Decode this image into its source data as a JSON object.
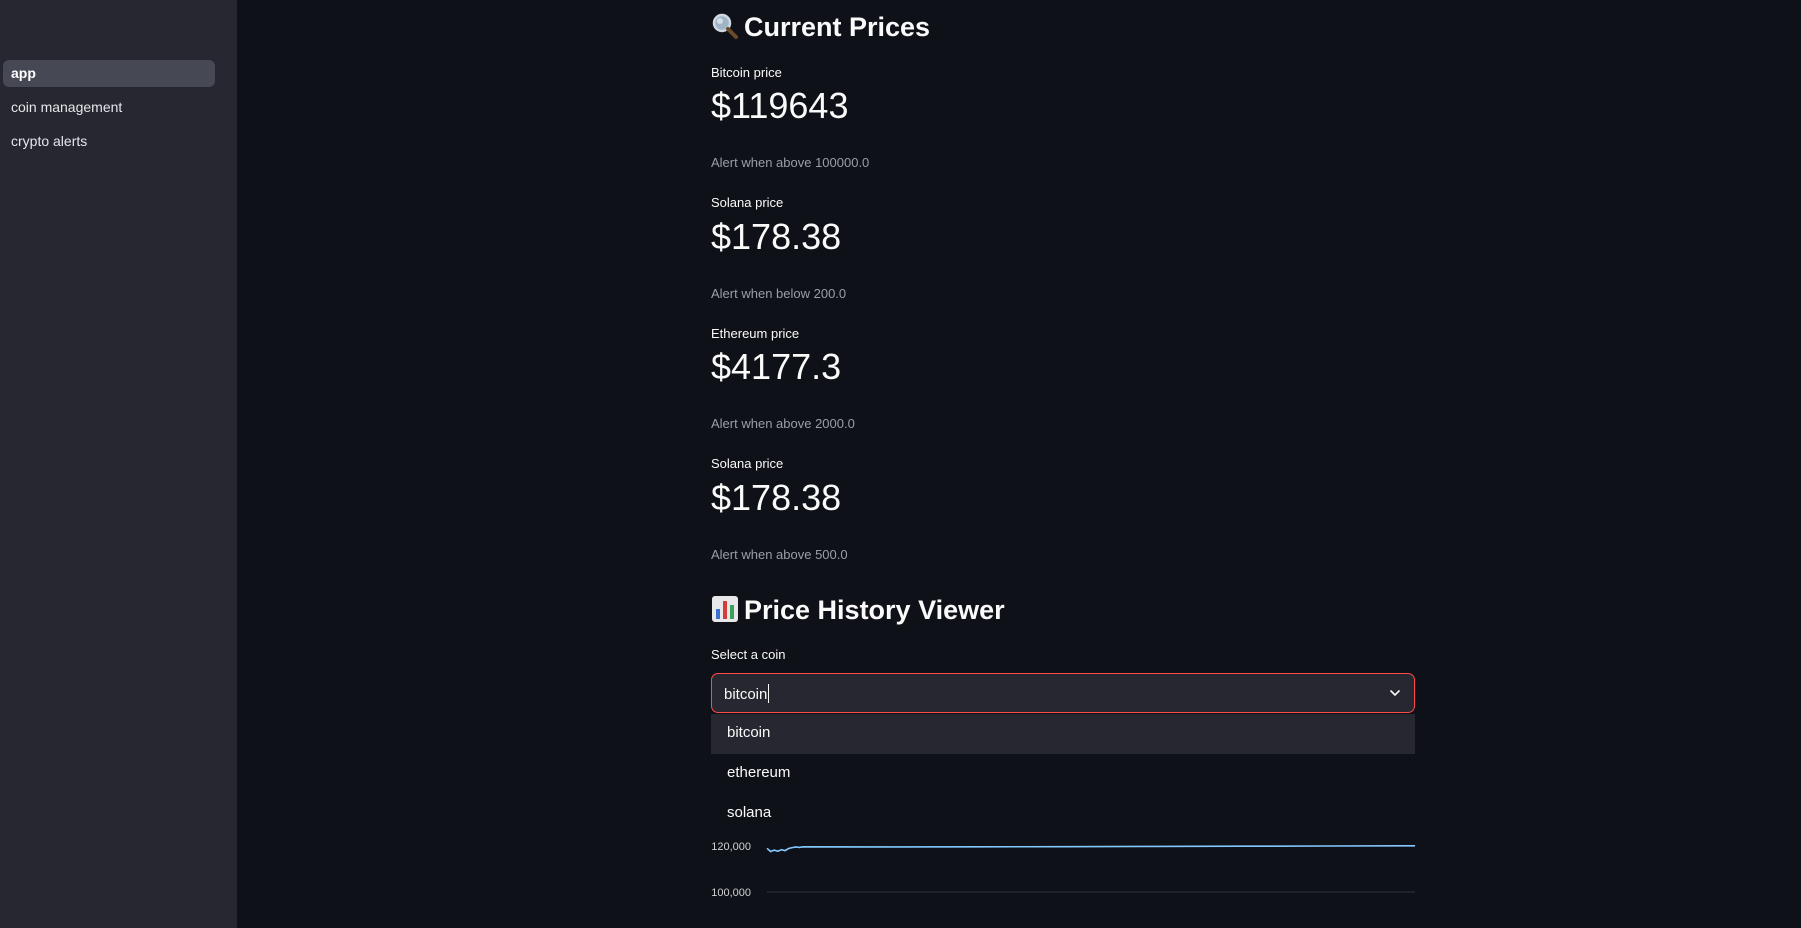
{
  "sidebar": {
    "items": [
      {
        "label": "app",
        "active": true
      },
      {
        "label": "coin management",
        "active": false
      },
      {
        "label": "crypto alerts",
        "active": false
      }
    ]
  },
  "current_prices": {
    "title": "Current Prices",
    "icon": "magnifying-glass-icon",
    "metrics": [
      {
        "label": "Bitcoin price",
        "value": "$119643",
        "caption": "Alert when above 100000.0"
      },
      {
        "label": "Solana price",
        "value": "$178.38",
        "caption": "Alert when below 200.0"
      },
      {
        "label": "Ethereum price",
        "value": "$4177.3",
        "caption": "Alert when above 2000.0"
      },
      {
        "label": "Solana price",
        "value": "$178.38",
        "caption": "Alert when above 500.0"
      }
    ]
  },
  "history": {
    "title": "Price History Viewer",
    "icon": "bar-chart-icon",
    "select_label": "Select a coin",
    "select_value": "bitcoin",
    "options": [
      "bitcoin",
      "ethereum",
      "solana"
    ]
  },
  "colors": {
    "accent": "#ff4b4b",
    "line": "#83c9ff",
    "background": "#0e1117",
    "sidebar": "#262730"
  },
  "chart_data": {
    "type": "line",
    "y_ticks": [
      "120,000",
      "100,000"
    ],
    "series": [
      {
        "values": [
          119000,
          117600,
          118200,
          117700,
          118400,
          118000,
          118900,
          119300,
          119600,
          119400,
          119643,
          119600,
          119650,
          119700,
          119800,
          119900,
          120000,
          120100
        ]
      }
    ]
  }
}
